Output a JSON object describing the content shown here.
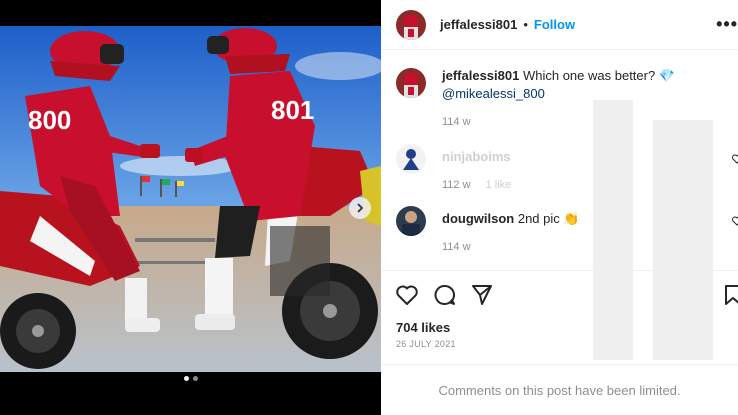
{
  "post": {
    "author": "jeffalessi801",
    "dot_separator": "•",
    "follow_label": "Follow",
    "more_label": "•••",
    "caption": {
      "username": "jeffalessi801",
      "text": "Which one was better?",
      "emoji": "💎",
      "mention": "@mikealessi_800",
      "age": "114 w"
    },
    "comments": [
      {
        "username": "ninjaboims",
        "text": "",
        "age": "112 w",
        "likes": "1 like"
      },
      {
        "username": "dougwilson",
        "text": "2nd pic",
        "emoji": "👏",
        "age": "114 w"
      }
    ],
    "likes": "704 likes",
    "date": "26 JULY 2021",
    "comments_limited": "Comments on this post have been limited."
  },
  "media": {
    "rider_left_number": "800",
    "rider_right_number": "801",
    "carousel_count": 2,
    "carousel_active": 0
  },
  "colors": {
    "accent": "#0095f6",
    "text": "#262626",
    "muted": "#8e8e8e",
    "jersey_red": "#c8102e"
  },
  "icons": {
    "like": "heart-icon",
    "comment": "comment-icon",
    "share": "share-icon",
    "save": "bookmark-icon",
    "next": "chevron-right-icon",
    "more": "more-options-icon"
  }
}
